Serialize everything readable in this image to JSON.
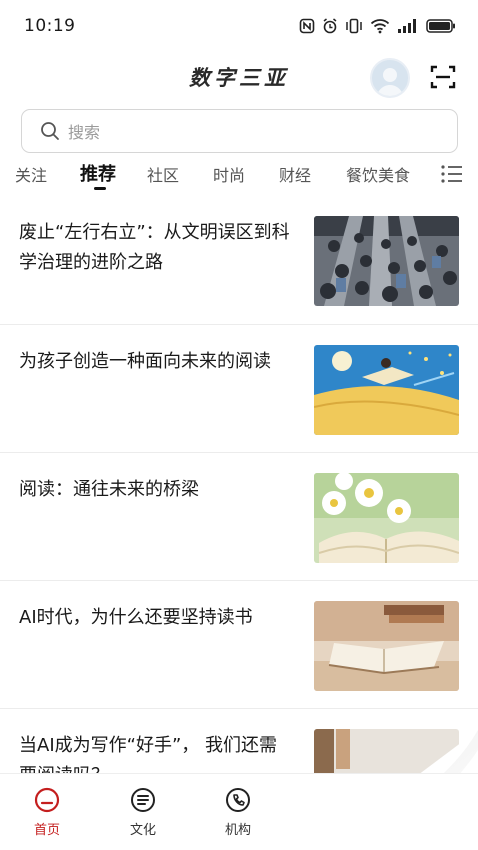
{
  "status_bar": {
    "time": "10:19"
  },
  "header": {
    "title": "数字三亚"
  },
  "search": {
    "placeholder": "搜索"
  },
  "tabs": [
    {
      "label": "关注",
      "active": false
    },
    {
      "label": "推荐",
      "active": true
    },
    {
      "label": "社区",
      "active": false
    },
    {
      "label": "时尚",
      "active": false
    },
    {
      "label": "财经",
      "active": false
    },
    {
      "label": "餐饮美食",
      "active": false
    }
  ],
  "articles": [
    {
      "title": "废止“左行右立”：从文明误区到科学治理的进阶之路",
      "thumb_icon": "escalator-crowd-image"
    },
    {
      "title": "为孩子创造一种面向未来的阅读",
      "thumb_icon": "reading-illustration-image"
    },
    {
      "title": "阅读：通往未来的桥梁",
      "thumb_icon": "book-flowers-image"
    },
    {
      "title": "AI时代，为什么还要坚持读书",
      "thumb_icon": "book-on-table-image"
    },
    {
      "title": "当AI成为写作“好手”， 我们还需要阅读吗？",
      "thumb_icon": "partial-image"
    }
  ],
  "bottom_nav": [
    {
      "label": "首页",
      "icon": "home-icon",
      "active": true
    },
    {
      "label": "文化",
      "icon": "culture-icon",
      "active": false
    },
    {
      "label": "机构",
      "icon": "phone-icon",
      "active": false
    }
  ],
  "colors": {
    "accent": "#c41e1e",
    "text": "#1a1a1a",
    "muted": "#9a9a9a"
  }
}
